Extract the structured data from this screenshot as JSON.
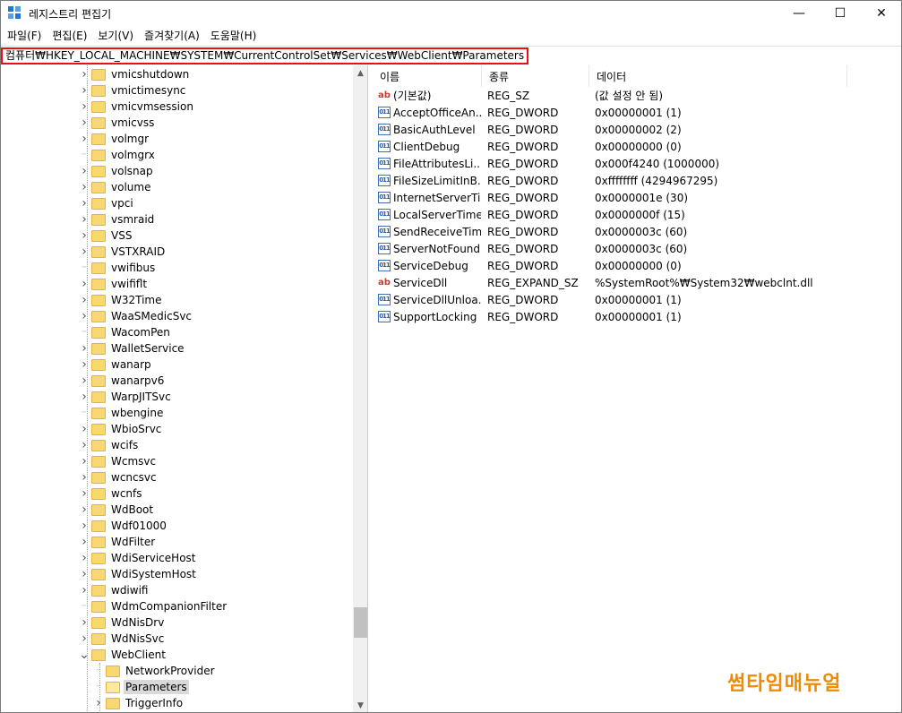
{
  "window": {
    "title": "레지스트리 편집기",
    "minimize_glyph": "—",
    "maximize_glyph": "☐",
    "close_glyph": "✕"
  },
  "menu": [
    "파일(F)",
    "편집(E)",
    "보기(V)",
    "즐겨찾기(A)",
    "도움말(H)"
  ],
  "address": "컴퓨터₩HKEY_LOCAL_MACHINE₩SYSTEM₩CurrentControlSet₩Services₩WebClient₩Parameters",
  "tree": [
    {
      "label": "vmicshutdown",
      "expandable": true
    },
    {
      "label": "vmictimesync",
      "expandable": true
    },
    {
      "label": "vmicvmsession",
      "expandable": true
    },
    {
      "label": "vmicvss",
      "expandable": true
    },
    {
      "label": "volmgr",
      "expandable": true
    },
    {
      "label": "volmgrx",
      "expandable": false
    },
    {
      "label": "volsnap",
      "expandable": true
    },
    {
      "label": "volume",
      "expandable": true
    },
    {
      "label": "vpci",
      "expandable": true
    },
    {
      "label": "vsmraid",
      "expandable": true
    },
    {
      "label": "VSS",
      "expandable": true
    },
    {
      "label": "VSTXRAID",
      "expandable": true
    },
    {
      "label": "vwifibus",
      "expandable": false
    },
    {
      "label": "vwififlt",
      "expandable": true
    },
    {
      "label": "W32Time",
      "expandable": true
    },
    {
      "label": "WaaSMedicSvc",
      "expandable": true
    },
    {
      "label": "WacomPen",
      "expandable": false
    },
    {
      "label": "WalletService",
      "expandable": true
    },
    {
      "label": "wanarp",
      "expandable": true
    },
    {
      "label": "wanarpv6",
      "expandable": true
    },
    {
      "label": "WarpJITSvc",
      "expandable": true
    },
    {
      "label": "wbengine",
      "expandable": false
    },
    {
      "label": "WbioSrvc",
      "expandable": true
    },
    {
      "label": "wcifs",
      "expandable": true
    },
    {
      "label": "Wcmsvc",
      "expandable": true
    },
    {
      "label": "wcncsvc",
      "expandable": true
    },
    {
      "label": "wcnfs",
      "expandable": true
    },
    {
      "label": "WdBoot",
      "expandable": true
    },
    {
      "label": "Wdf01000",
      "expandable": true
    },
    {
      "label": "WdFilter",
      "expandable": true
    },
    {
      "label": "WdiServiceHost",
      "expandable": true
    },
    {
      "label": "WdiSystemHost",
      "expandable": true
    },
    {
      "label": "wdiwifi",
      "expandable": true
    },
    {
      "label": "WdmCompanionFilter",
      "expandable": false
    },
    {
      "label": "WdNisDrv",
      "expandable": true
    },
    {
      "label": "WdNisSvc",
      "expandable": true
    },
    {
      "label": "WebClient",
      "expandable": true,
      "expanded": true
    },
    {
      "label": "NetworkProvider",
      "expandable": false,
      "child": true
    },
    {
      "label": "Parameters",
      "expandable": false,
      "child": true,
      "selected": true
    },
    {
      "label": "TriggerInfo",
      "expandable": true,
      "child": true
    }
  ],
  "columns": {
    "name": "이름",
    "type": "종류",
    "data": "데이터"
  },
  "values": [
    {
      "name": "(기본값)",
      "type": "REG_SZ",
      "data": "(값 설정 안 됨)",
      "icon": "string-icon"
    },
    {
      "name": "AcceptOfficeAn...",
      "type": "REG_DWORD",
      "data": "0x00000001 (1)",
      "icon": "binary-icon"
    },
    {
      "name": "BasicAuthLevel",
      "type": "REG_DWORD",
      "data": "0x00000002 (2)",
      "icon": "binary-icon"
    },
    {
      "name": "ClientDebug",
      "type": "REG_DWORD",
      "data": "0x00000000 (0)",
      "icon": "binary-icon"
    },
    {
      "name": "FileAttributesLi...",
      "type": "REG_DWORD",
      "data": "0x000f4240 (1000000)",
      "icon": "binary-icon"
    },
    {
      "name": "FileSizeLimitInB...",
      "type": "REG_DWORD",
      "data": "0xffffffff (4294967295)",
      "icon": "binary-icon"
    },
    {
      "name": "InternetServerTi...",
      "type": "REG_DWORD",
      "data": "0x0000001e (30)",
      "icon": "binary-icon"
    },
    {
      "name": "LocalServerTime...",
      "type": "REG_DWORD",
      "data": "0x0000000f (15)",
      "icon": "binary-icon"
    },
    {
      "name": "SendReceiveTim...",
      "type": "REG_DWORD",
      "data": "0x0000003c (60)",
      "icon": "binary-icon"
    },
    {
      "name": "ServerNotFound...",
      "type": "REG_DWORD",
      "data": "0x0000003c (60)",
      "icon": "binary-icon"
    },
    {
      "name": "ServiceDebug",
      "type": "REG_DWORD",
      "data": "0x00000000 (0)",
      "icon": "binary-icon"
    },
    {
      "name": "ServiceDll",
      "type": "REG_EXPAND_SZ",
      "data": "%SystemRoot%₩System32₩webclnt.dll",
      "icon": "string-icon"
    },
    {
      "name": "ServiceDllUnloa...",
      "type": "REG_DWORD",
      "data": "0x00000001 (1)",
      "icon": "binary-icon"
    },
    {
      "name": "SupportLocking",
      "type": "REG_DWORD",
      "data": "0x00000001 (1)",
      "icon": "binary-icon"
    }
  ],
  "icon_glyphs": {
    "string": "ab",
    "binary": "011"
  },
  "watermark": "썸타임매뉴얼",
  "colors": {
    "highlight_border": "#e81010",
    "watermark": "#f08a00",
    "folder": "#f8d775"
  }
}
